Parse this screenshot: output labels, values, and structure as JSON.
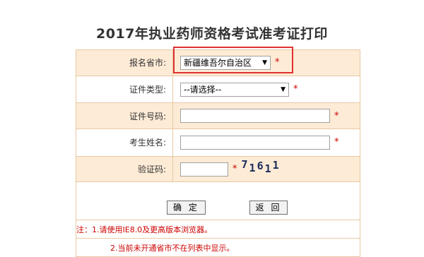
{
  "page_title": "2017年执业药师资格考试准考证打印",
  "form": {
    "province": {
      "label": "报名省市:",
      "value": "新疆维吾尔自治区",
      "required_mark": "*"
    },
    "id_type": {
      "label": "证件类型:",
      "value": "--请选择--",
      "required_mark": "*"
    },
    "id_number": {
      "label": "证件号码:",
      "value": "",
      "required_mark": "*"
    },
    "name": {
      "label": "考生姓名:",
      "value": "",
      "required_mark": "*"
    },
    "captcha": {
      "label": "验证码:",
      "value": "",
      "required_mark": "*",
      "image_text": "71611"
    }
  },
  "buttons": {
    "confirm": "确 定",
    "back": "返 回"
  },
  "notes": {
    "line1": "注：1.请使用IE8.0及更高版本浏览器。",
    "line2": "2.当前未开通省市不在列表中显示。"
  },
  "colors": {
    "border": "#e7c9a2",
    "alt_row_bg": "#fdebd6",
    "required": "#cc0000",
    "highlight": "#e03030"
  }
}
